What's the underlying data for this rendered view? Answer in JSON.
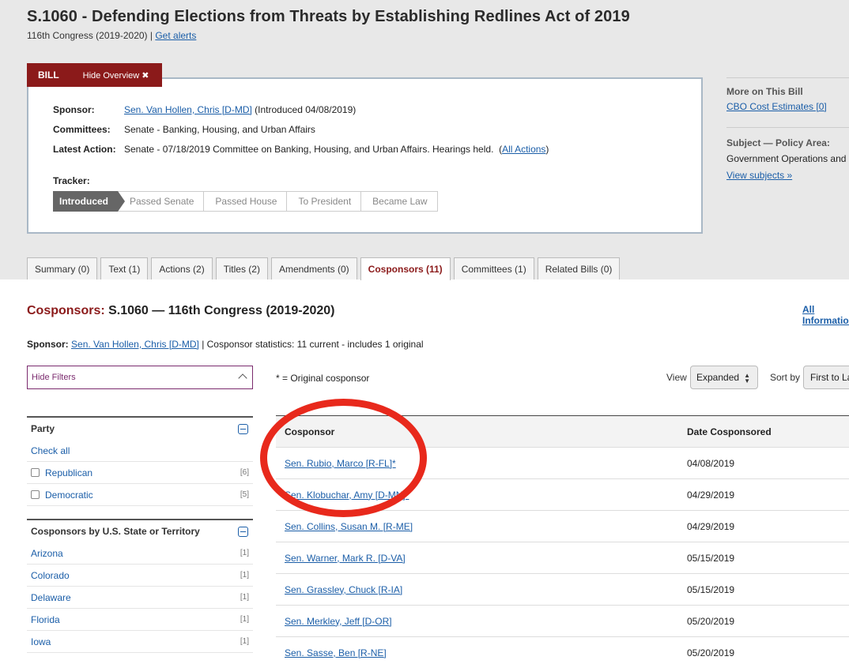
{
  "bill": {
    "title": "S.1060 - Defending Elections from Threats by Establishing Redlines Act of 2019",
    "congress": "116th Congress (2019-2020)",
    "separator": " | ",
    "get_alerts": "Get alerts"
  },
  "overview": {
    "tab_label": "BILL",
    "hide_label": "Hide Overview ✖",
    "sponsor_label": "Sponsor:",
    "sponsor_link": "Sen. Van Hollen, Chris [D-MD]",
    "sponsor_extra": " (Introduced 04/08/2019)",
    "committees_label": "Committees:",
    "committees_value": "Senate - Banking, Housing, and Urban Affairs",
    "latest_label": "Latest Action:",
    "latest_value": "Senate - 07/18/2019 Committee on Banking, Housing, and Urban Affairs. Hearings held.  (",
    "all_actions": "All Actions",
    "latest_close": ")",
    "tracker_label": "Tracker:",
    "tracker_steps": [
      "Introduced",
      "Passed Senate",
      "Passed House",
      "To President",
      "Became Law"
    ]
  },
  "sidebar": {
    "more_title": "More on This Bill",
    "cbo_link": "CBO Cost Estimates [0]",
    "subject_title": "Subject — Policy Area:",
    "subject_value": "Government Operations and Politics",
    "view_subjects": "View subjects »"
  },
  "tabs": [
    {
      "label": "Summary (0)"
    },
    {
      "label": "Text (1)"
    },
    {
      "label": "Actions (2)"
    },
    {
      "label": "Titles (2)"
    },
    {
      "label": "Amendments (0)"
    },
    {
      "label": "Cosponsors (11)"
    },
    {
      "label": "Committees (1)"
    },
    {
      "label": "Related Bills (0)"
    }
  ],
  "main": {
    "heading_red": "Cosponsors:",
    "heading_rest": " S.1060 — 116th Congress (2019-2020)",
    "all_information": "All Information",
    "sponsor_label": "Sponsor:",
    "sponsor_link": "Sen. Van Hollen, Chris [D-MD]",
    "sponsor_stats": " | Cosponsor statistics: 11 current - includes 1 original",
    "hide_filters": "Hide Filters",
    "original_note": "* = Original cosponsor",
    "view_label": "View",
    "view_value": "Expanded",
    "sort_label": "Sort by",
    "sort_value": "First to Last"
  },
  "filters": {
    "party_title": "Party",
    "check_all": "Check all",
    "party_items": [
      {
        "label": "Republican",
        "count": "[6]"
      },
      {
        "label": "Democratic",
        "count": "[5]"
      }
    ],
    "state_title": "Cosponsors by U.S. State or Territory",
    "state_items": [
      {
        "label": "Arizona",
        "count": "[1]"
      },
      {
        "label": "Colorado",
        "count": "[1]"
      },
      {
        "label": "Delaware",
        "count": "[1]"
      },
      {
        "label": "Florida",
        "count": "[1]"
      },
      {
        "label": "Iowa",
        "count": "[1]"
      }
    ]
  },
  "table": {
    "col_cosponsor": "Cosponsor",
    "col_date": "Date Cosponsored",
    "rows": [
      {
        "name": "Sen. Rubio, Marco [R-FL]*",
        "date": "04/08/2019"
      },
      {
        "name": "Sen. Klobuchar, Amy [D-MN]*",
        "date": "04/29/2019"
      },
      {
        "name": "Sen. Collins, Susan M. [R-ME]",
        "date": "04/29/2019"
      },
      {
        "name": "Sen. Warner, Mark R. [D-VA]",
        "date": "05/15/2019"
      },
      {
        "name": "Sen. Grassley, Chuck [R-IA]",
        "date": "05/15/2019"
      },
      {
        "name": "Sen. Merkley, Jeff [D-OR]",
        "date": "05/20/2019"
      },
      {
        "name": "Sen. Sasse, Ben [R-NE]",
        "date": "05/20/2019"
      }
    ]
  },
  "colors": {
    "brand_red": "#8b1a1a",
    "link_blue": "#1b5ea8",
    "annotation_red": "#e8291c"
  }
}
